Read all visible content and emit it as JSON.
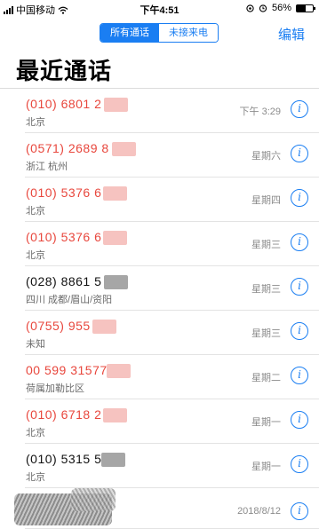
{
  "status_bar": {
    "carrier": "中国移动",
    "time": "下午4:51",
    "battery_percent": "56%",
    "battery_level": 0.56,
    "icons": [
      "signal-icon",
      "wifi-icon",
      "location-icon",
      "alarm-icon",
      "battery-icon"
    ]
  },
  "header": {
    "tabs": [
      {
        "label": "所有通话",
        "active": true
      },
      {
        "label": "未接来电",
        "active": false
      }
    ],
    "edit_label": "编辑",
    "title": "最近通话"
  },
  "calls": [
    {
      "number": "(010) 6801 2",
      "location": "北京",
      "date": "下午 3:29",
      "missed": true
    },
    {
      "number": "(0571) 2689 8",
      "location": "浙江 杭州",
      "date": "星期六",
      "missed": true
    },
    {
      "number": "(010) 5376 6",
      "location": "北京",
      "date": "星期四",
      "missed": true
    },
    {
      "number": "(010) 5376 6",
      "location": "北京",
      "date": "星期三",
      "missed": true
    },
    {
      "number": "(028) 8861 5",
      "location": "四川 成都/眉山/资阳",
      "date": "星期三",
      "missed": false
    },
    {
      "number": "(0755) 955",
      "location": "未知",
      "date": "星期三",
      "missed": true
    },
    {
      "number": "00 599 31577",
      "location": "荷属加勒比区",
      "date": "星期二",
      "missed": true
    },
    {
      "number": "(010) 6718 2",
      "location": "北京",
      "date": "星期一",
      "missed": true
    },
    {
      "number": "(010) 5315 5",
      "location": "北京",
      "date": "星期一",
      "missed": false
    },
    {
      "number": "",
      "location": "",
      "date": "2018/8/12",
      "missed": false
    }
  ],
  "colors": {
    "accent": "#1a7ef2",
    "missed": "#e8473d"
  }
}
